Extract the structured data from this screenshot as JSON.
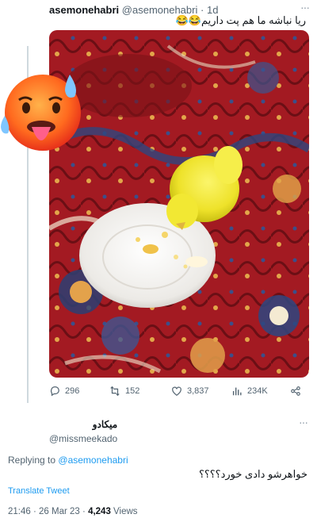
{
  "tweet": {
    "display_name": "asemonehabri",
    "handle": "@asemonehabri",
    "separator": "·",
    "time": "1d",
    "more": "···",
    "text": "ریا نباشه ما هم پت داریم😂😂",
    "stats": {
      "replies": "296",
      "retweets": "152",
      "likes": "3,837",
      "views": "234K"
    }
  },
  "overlay": {
    "emoji_icon": "hot-face-emoji"
  },
  "reply": {
    "display_name": "میکادو",
    "handle": "@missmeekado",
    "more": "···",
    "replying_prefix": "Replying to",
    "replying_to": "@asemonehabri",
    "text": "خواهرشو دادی خورد؟؟؟؟",
    "translate": "Translate Tweet",
    "time": "21:46",
    "dot": "·",
    "date": "26 Mar 23",
    "views_count": "4,243",
    "views_label": "Views"
  },
  "colors": {
    "accent": "#1d9bf0",
    "muted": "#536471",
    "carpet": "#9a1820",
    "bird": "#f4ec2c"
  }
}
